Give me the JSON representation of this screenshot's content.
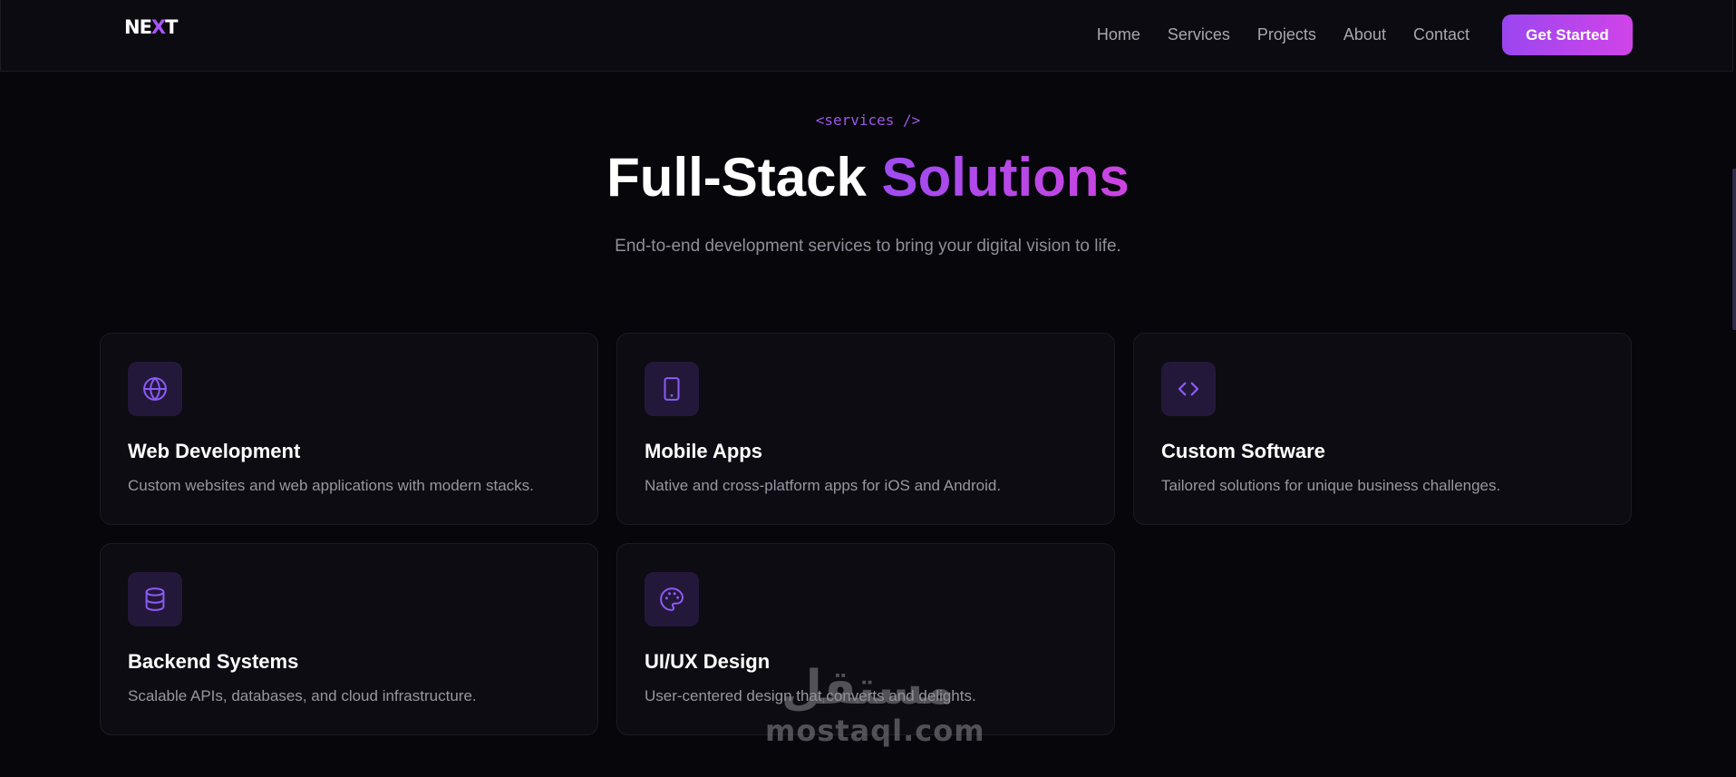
{
  "header": {
    "logo_prefix": "NE",
    "logo_x": "X",
    "logo_suffix": "T",
    "nav": [
      "Home",
      "Services",
      "Projects",
      "About",
      "Contact"
    ],
    "cta_label": "Get Started"
  },
  "section": {
    "eyebrow": "<services />",
    "title_plain": "Full-Stack ",
    "title_accent": "Solutions",
    "subtitle": "End-to-end development services to bring your digital vision to life."
  },
  "cards": [
    {
      "icon": "globe-icon",
      "title": "Web Development",
      "desc": "Custom websites and web applications with modern stacks."
    },
    {
      "icon": "tablet-icon",
      "title": "Mobile Apps",
      "desc": "Native and cross-platform apps for iOS and Android."
    },
    {
      "icon": "code-icon",
      "title": "Custom Software",
      "desc": "Tailored solutions for unique business challenges."
    },
    {
      "icon": "database-icon",
      "title": "Backend Systems",
      "desc": "Scalable APIs, databases, and cloud infrastructure."
    },
    {
      "icon": "palette-icon",
      "title": "UI/UX Design",
      "desc": "User-centered design that converts and delights."
    }
  ],
  "watermark": {
    "arabic": "مستقل",
    "latin": "mostaql.com"
  },
  "colors": {
    "background": "#07060b",
    "accent_purple": "#9b46f0",
    "accent_magenta": "#d044e8",
    "icon_tile": "#24183a",
    "icon_stroke": "#8b5cf6"
  }
}
